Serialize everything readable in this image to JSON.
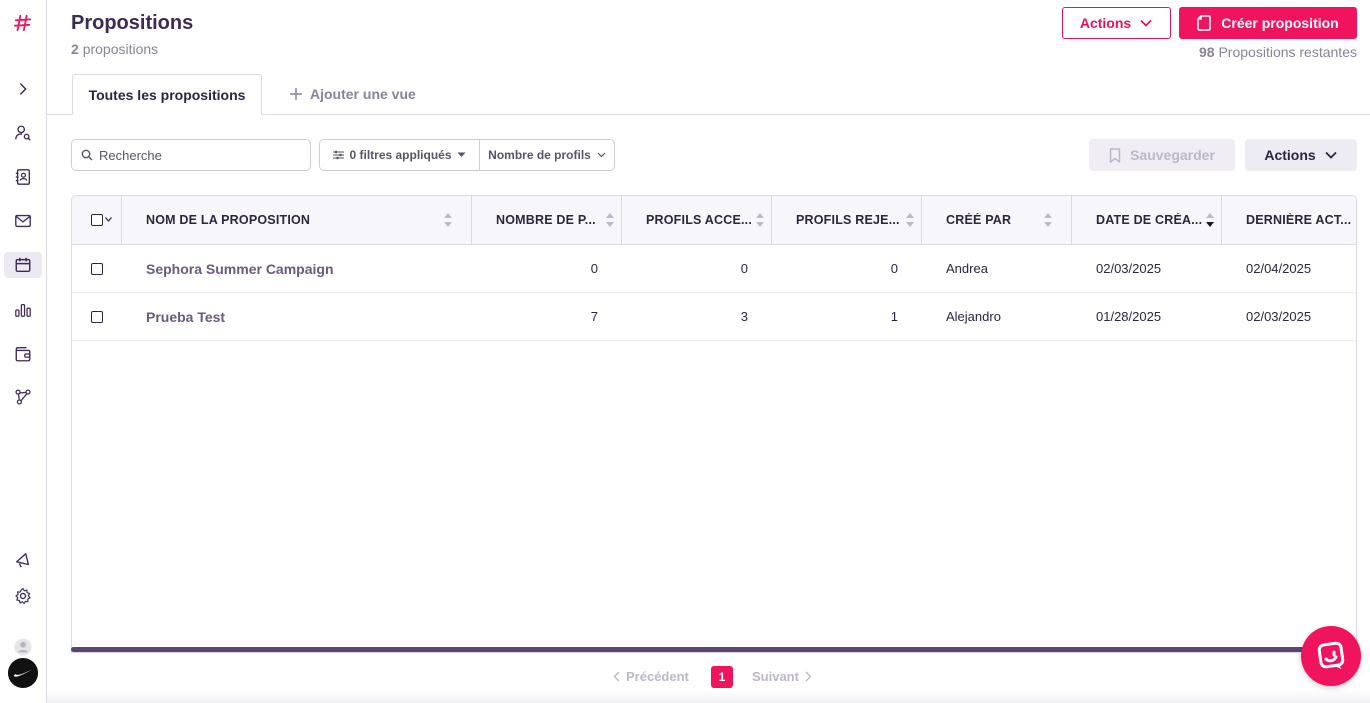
{
  "header": {
    "title": "Propositions",
    "count": "2",
    "count_label": "propositions",
    "actions_label": "Actions",
    "create_label": "Créer proposition",
    "remaining_count": "98",
    "remaining_label": "Propositions restantes"
  },
  "tabs": {
    "active": "Toutes les propositions",
    "add": "Ajouter une vue"
  },
  "toolbar": {
    "search_placeholder": "Recherche",
    "filters_label": "0 filtres appliqués",
    "profiles_filter": "Nombre de profils",
    "save_label": "Sauvegarder",
    "actions_label": "Actions"
  },
  "table": {
    "columns": [
      "NOM DE LA PROPOSITION",
      "NOMBRE DE P...",
      "PROFILS ACCE...",
      "PROFILS REJE...",
      "CRÉÉ PAR",
      "DATE DE CRÉA...",
      "DERNIÈRE ACT..."
    ],
    "rows": [
      {
        "name": "Sephora Summer Campaign",
        "profiles": "0",
        "accepted": "0",
        "rejected": "0",
        "created_by": "Andrea",
        "created_date": "02/03/2025",
        "last_activity": "02/04/2025"
      },
      {
        "name": "Prueba Test",
        "profiles": "7",
        "accepted": "3",
        "rejected": "1",
        "created_by": "Alejandro",
        "created_date": "01/28/2025",
        "last_activity": "02/03/2025"
      }
    ]
  },
  "pagination": {
    "prev": "Précédent",
    "current": "1",
    "next": "Suivant"
  },
  "colors": {
    "accent": "#f0145e",
    "primary_text": "#3d2a55",
    "muted": "#8a8299"
  },
  "sidebar": {
    "icons": [
      "logo-hash-icon",
      "expand-chevron-icon",
      "user-search-icon",
      "contacts-icon",
      "mail-icon",
      "calendar-icon",
      "bar-chart-icon",
      "wallet-icon",
      "workflow-icon",
      "megaphone-icon",
      "settings-gear-icon",
      "user-avatar-icon",
      "brand-logo-icon"
    ]
  }
}
